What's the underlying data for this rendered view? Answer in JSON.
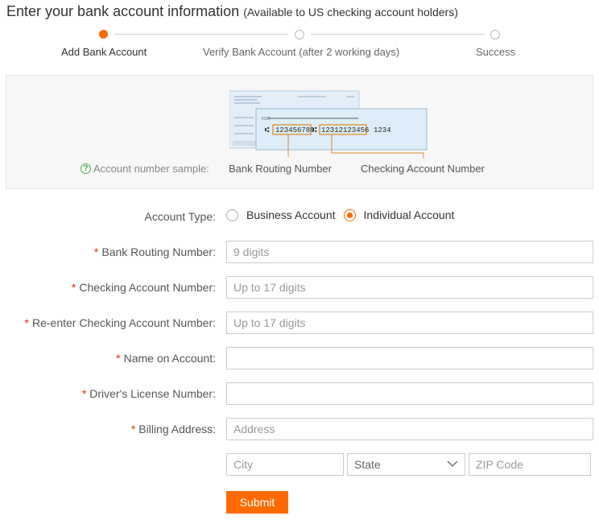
{
  "header": {
    "title": "Enter your bank account information",
    "subtitle": "(Available to US checking account holders)"
  },
  "steps": [
    {
      "label": "Add Bank Account",
      "state": "active"
    },
    {
      "label": "Verify Bank Account (after 2 working days)",
      "state": "pending"
    },
    {
      "label": "Success",
      "state": "pending"
    }
  ],
  "sample": {
    "label": "Account number sample:",
    "routing_caption": "Bank Routing Number",
    "account_caption": "Checking Account Number",
    "check_routing": "123456789",
    "check_account": "12312123456",
    "check_number": "1234",
    "check_for": "FOR"
  },
  "form": {
    "account_type": {
      "label": "Account Type:",
      "options": [
        "Business Account",
        "Individual Account"
      ],
      "selected": "Individual Account"
    },
    "routing": {
      "label": "Bank Routing Number:",
      "placeholder": "9 digits",
      "value": ""
    },
    "checking": {
      "label": "Checking Account Number:",
      "placeholder": "Up to 17 digits",
      "value": ""
    },
    "recheck": {
      "label": "Re-enter Checking Account Number:",
      "placeholder": "Up to 17 digits",
      "value": ""
    },
    "name": {
      "label": "Name on Account:",
      "placeholder": "",
      "value": ""
    },
    "license": {
      "label": "Driver's License Number:",
      "placeholder": "",
      "value": ""
    },
    "address": {
      "label": "Billing Address:",
      "placeholder": "Address",
      "value": ""
    },
    "city": {
      "placeholder": "City"
    },
    "state": {
      "selected": "State"
    },
    "zip": {
      "placeholder": "ZIP Code"
    },
    "required_mark": "*",
    "submit_label": "Submit"
  },
  "colors": {
    "accent": "#ff6a00",
    "required": "#e62e04",
    "help": "#4caf50"
  }
}
